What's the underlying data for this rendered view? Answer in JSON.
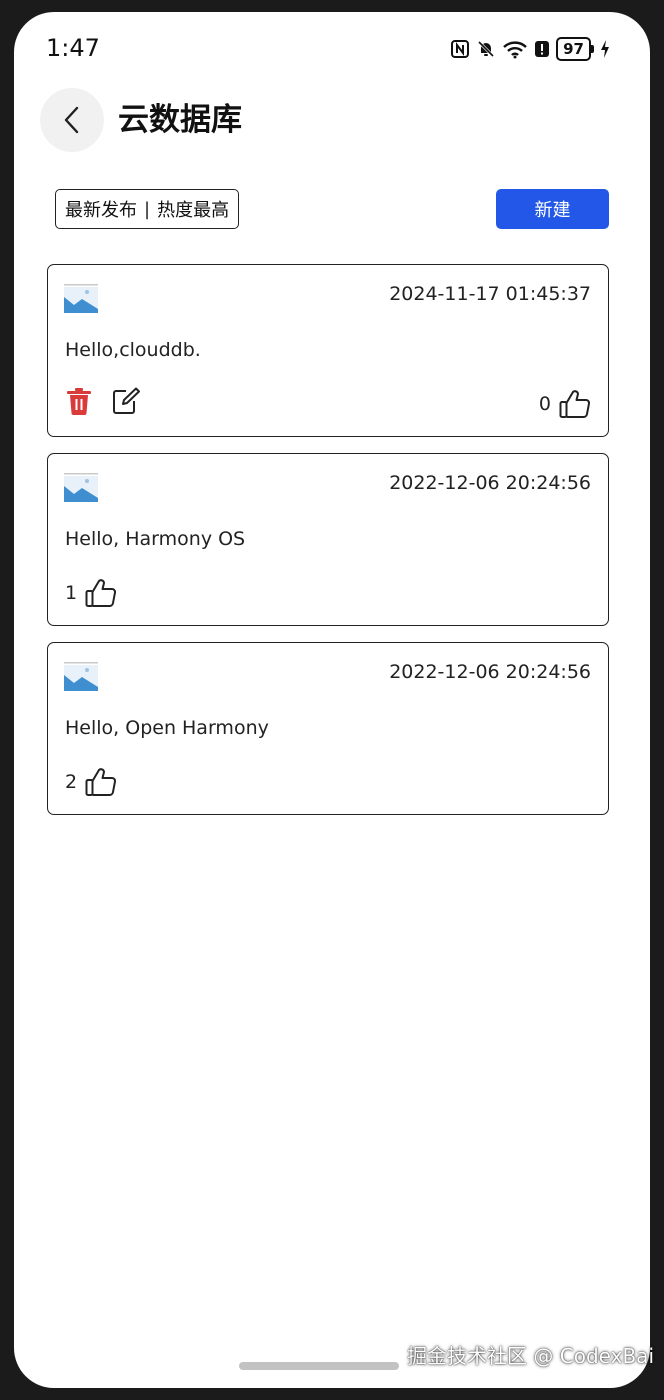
{
  "status_bar": {
    "time": "1:47",
    "battery": "97",
    "icons": [
      "nfc-icon",
      "bell-off-icon",
      "wifi-icon",
      "alert-icon",
      "battery-icon",
      "charging-icon"
    ]
  },
  "header": {
    "title": "云数据库",
    "back_icon": "chevron-left-icon"
  },
  "toolbar": {
    "sort_latest": "最新发布",
    "sort_separator": "|",
    "sort_hottest": "热度最高",
    "new_label": "新建"
  },
  "colors": {
    "primary": "#2357e8",
    "delete": "#d93a3a",
    "image_placeholder": "#3e8ed0"
  },
  "posts": [
    {
      "time": "2024-11-17 01:45:37",
      "text": "Hello,clouddb.",
      "likes": "0",
      "editable": true
    },
    {
      "time": "2022-12-06 20:24:56",
      "text": "Hello, Harmony OS",
      "likes": "1",
      "editable": false
    },
    {
      "time": "2022-12-06 20:24:56",
      "text": "Hello, Open Harmony",
      "likes": "2",
      "editable": false
    }
  ],
  "watermark": "掘金技术社区 @ CodexBai"
}
